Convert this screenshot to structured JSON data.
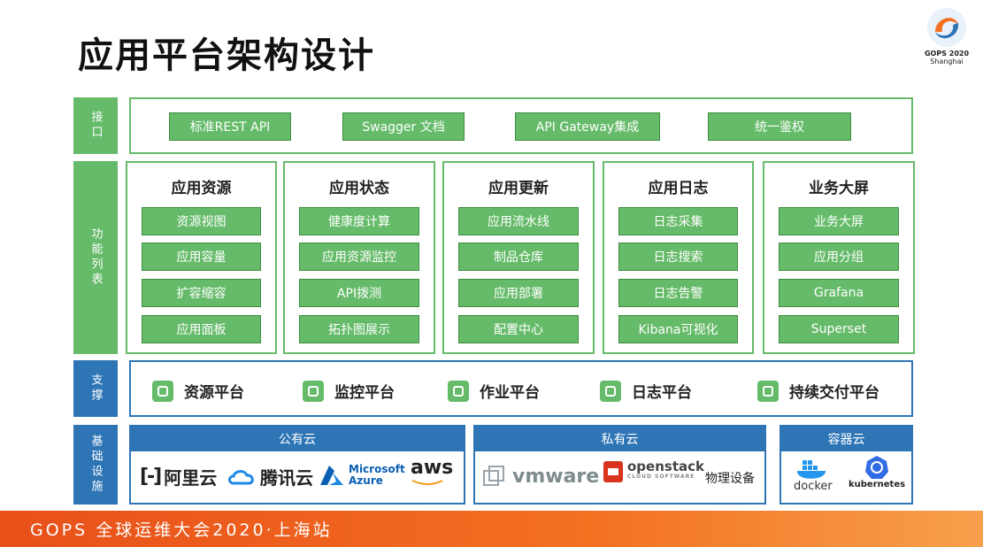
{
  "title": "应用平台架构设计",
  "logo": {
    "line1": "GOPS 2020",
    "line2": "Shanghai"
  },
  "rows": {
    "interface": "接口",
    "features": "功能列表",
    "support": "支撑",
    "infra": "基础设施"
  },
  "interface_items": [
    "标准REST API",
    "Swagger 文档",
    "API Gateway集成",
    "统一鉴权"
  ],
  "columns": [
    {
      "title": "应用资源",
      "items": [
        "资源视图",
        "应用容量",
        "扩容缩容",
        "应用面板"
      ]
    },
    {
      "title": "应用状态",
      "items": [
        "健康度计算",
        "应用资源监控",
        "API拨测",
        "拓扑图展示"
      ]
    },
    {
      "title": "应用更新",
      "items": [
        "应用流水线",
        "制品仓库",
        "应用部署",
        "配置中心"
      ]
    },
    {
      "title": "应用日志",
      "items": [
        "日志采集",
        "日志搜索",
        "日志告警",
        "Kibana可视化"
      ]
    },
    {
      "title": "业务大屏",
      "items": [
        "业务大屏",
        "应用分组",
        "Grafana",
        "Superset"
      ]
    }
  ],
  "support_items": [
    {
      "label": "资源平台",
      "icon": "pie-chart-icon"
    },
    {
      "label": "监控平台",
      "icon": "monitor-chart-icon"
    },
    {
      "label": "作业平台",
      "icon": "document-search-icon"
    },
    {
      "label": "日志平台",
      "icon": "cube-icon"
    },
    {
      "label": "持续交付平台",
      "icon": "toggle-icon"
    }
  ],
  "clouds": {
    "public": {
      "header": "公有云",
      "brands": [
        "阿里云",
        "腾讯云",
        "Microsoft",
        "Azure",
        "aws"
      ]
    },
    "private": {
      "header": "私有云",
      "brands": [
        "vmware",
        "openstack",
        "CLOUD SOFTWARE",
        "物理设备"
      ]
    },
    "container": {
      "header": "容器云",
      "brands": [
        "docker",
        "kubernetes"
      ]
    }
  },
  "footer": "GOPS 全球运维大会2020·上海站",
  "colors": {
    "green": "#66bb6a",
    "blue": "#2e75b6",
    "orange": "#f37021"
  }
}
